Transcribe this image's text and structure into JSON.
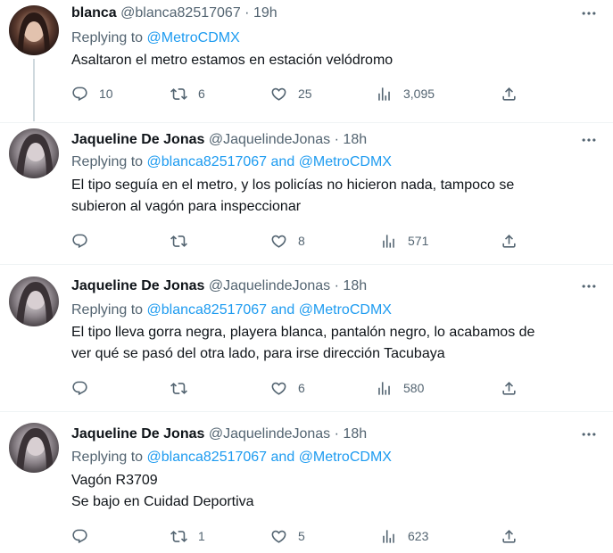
{
  "tweets": [
    {
      "name": "blanca",
      "handle": "@blanca82517067",
      "dot": "·",
      "time": "19h",
      "replying_prefix": "Replying to",
      "mention1": "@MetroCDMX",
      "mention_joiner": "",
      "mention2": "",
      "text_lines": [
        "Asaltaron el metro estamos en estación velódromo"
      ],
      "replies": "10",
      "retweets": "6",
      "likes": "25",
      "views": "3,095"
    },
    {
      "name": "Jaqueline De Jonas",
      "handle": "@JaquelindeJonas",
      "dot": "·",
      "time": "18h",
      "replying_prefix": "Replying to",
      "mention1": "@blanca82517067",
      "mention_joiner": "and",
      "mention2": "@MetroCDMX",
      "text_lines": [
        "El tipo seguía en el metro, y los policías no hicieron nada, tampoco se",
        "subieron al vagón para inspeccionar"
      ],
      "replies": "",
      "retweets": "",
      "likes": "8",
      "views": "571"
    },
    {
      "name": "Jaqueline De Jonas",
      "handle": "@JaquelindeJonas",
      "dot": "·",
      "time": "18h",
      "replying_prefix": "Replying to",
      "mention1": "@blanca82517067",
      "mention_joiner": "and",
      "mention2": "@MetroCDMX",
      "text_lines": [
        "El tipo lleva gorra negra, playera blanca, pantalón negro, lo acabamos de",
        "ver qué se pasó del otra lado, para irse dirección Tacubaya"
      ],
      "replies": "",
      "retweets": "",
      "likes": "6",
      "views": "580"
    },
    {
      "name": "Jaqueline De Jonas",
      "handle": "@JaquelindeJonas",
      "dot": "·",
      "time": "18h",
      "replying_prefix": "Replying to",
      "mention1": "@blanca82517067",
      "mention_joiner": "and",
      "mention2": "@MetroCDMX",
      "text_lines": [
        "Vagón R3709",
        "Se bajo en Cuidad Deportiva"
      ],
      "replies": "",
      "retweets": "1",
      "likes": "5",
      "views": "623"
    }
  ],
  "icons": {
    "reply": "reply-icon",
    "retweet": "retweet-icon",
    "like": "heart-icon",
    "views": "views-icon",
    "share": "share-icon",
    "more": "more-icon"
  },
  "colors": {
    "accent": "#1d9bf0",
    "secondary_text": "#536471",
    "primary_text": "#0f1419",
    "divider": "#eff3f4"
  }
}
